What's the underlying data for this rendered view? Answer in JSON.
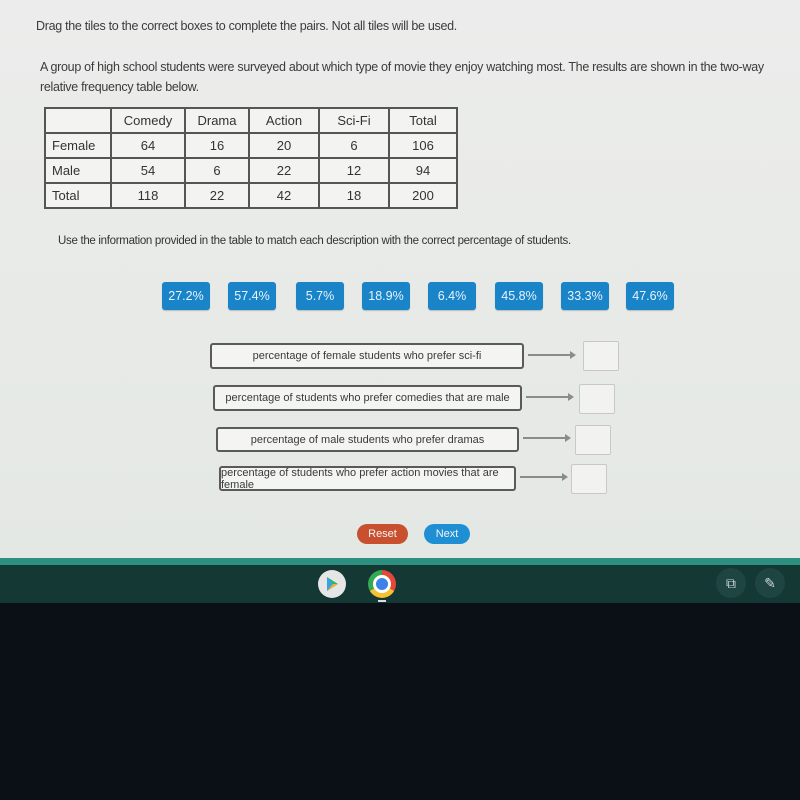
{
  "instructions": "Drag the tiles to the correct boxes to complete the pairs. Not all tiles will be used.",
  "intro": "A group of high school students were surveyed about which type of movie they enjoy watching most. The results are shown in the two-way relative frequency table below.",
  "table": {
    "headers": [
      "",
      "Comedy",
      "Drama",
      "Action",
      "Sci-Fi",
      "Total"
    ],
    "rows": [
      {
        "label": "Female",
        "values": [
          "64",
          "16",
          "20",
          "6",
          "106"
        ]
      },
      {
        "label": "Male",
        "values": [
          "54",
          "6",
          "22",
          "12",
          "94"
        ]
      },
      {
        "label": "Total",
        "values": [
          "118",
          "22",
          "42",
          "18",
          "200"
        ]
      }
    ]
  },
  "prompt": "Use the information provided in the table to match each description with the correct percentage of students.",
  "tiles": [
    "27.2%",
    "57.4%",
    "5.7%",
    "18.9%",
    "6.4%",
    "45.8%",
    "33.3%",
    "47.6%"
  ],
  "pairs": [
    {
      "description": "percentage of female students who prefer sci-fi",
      "answer": ""
    },
    {
      "description": "percentage of students who prefer comedies that are male",
      "answer": ""
    },
    {
      "description": "percentage of male students who prefer dramas",
      "answer": ""
    },
    {
      "description": "percentage of students who prefer action movies that are female",
      "answer": ""
    }
  ],
  "buttons": {
    "reset": "Reset",
    "next": "Next"
  },
  "shelf": {
    "apps": [
      "play-store-icon",
      "chrome-icon"
    ],
    "system": [
      "screen-capture-icon",
      "stylus-icon"
    ]
  },
  "colors": {
    "tile": "#1a84c9",
    "reset": "#c9502f",
    "next": "#1f8fd4",
    "shelf": "#143834"
  }
}
